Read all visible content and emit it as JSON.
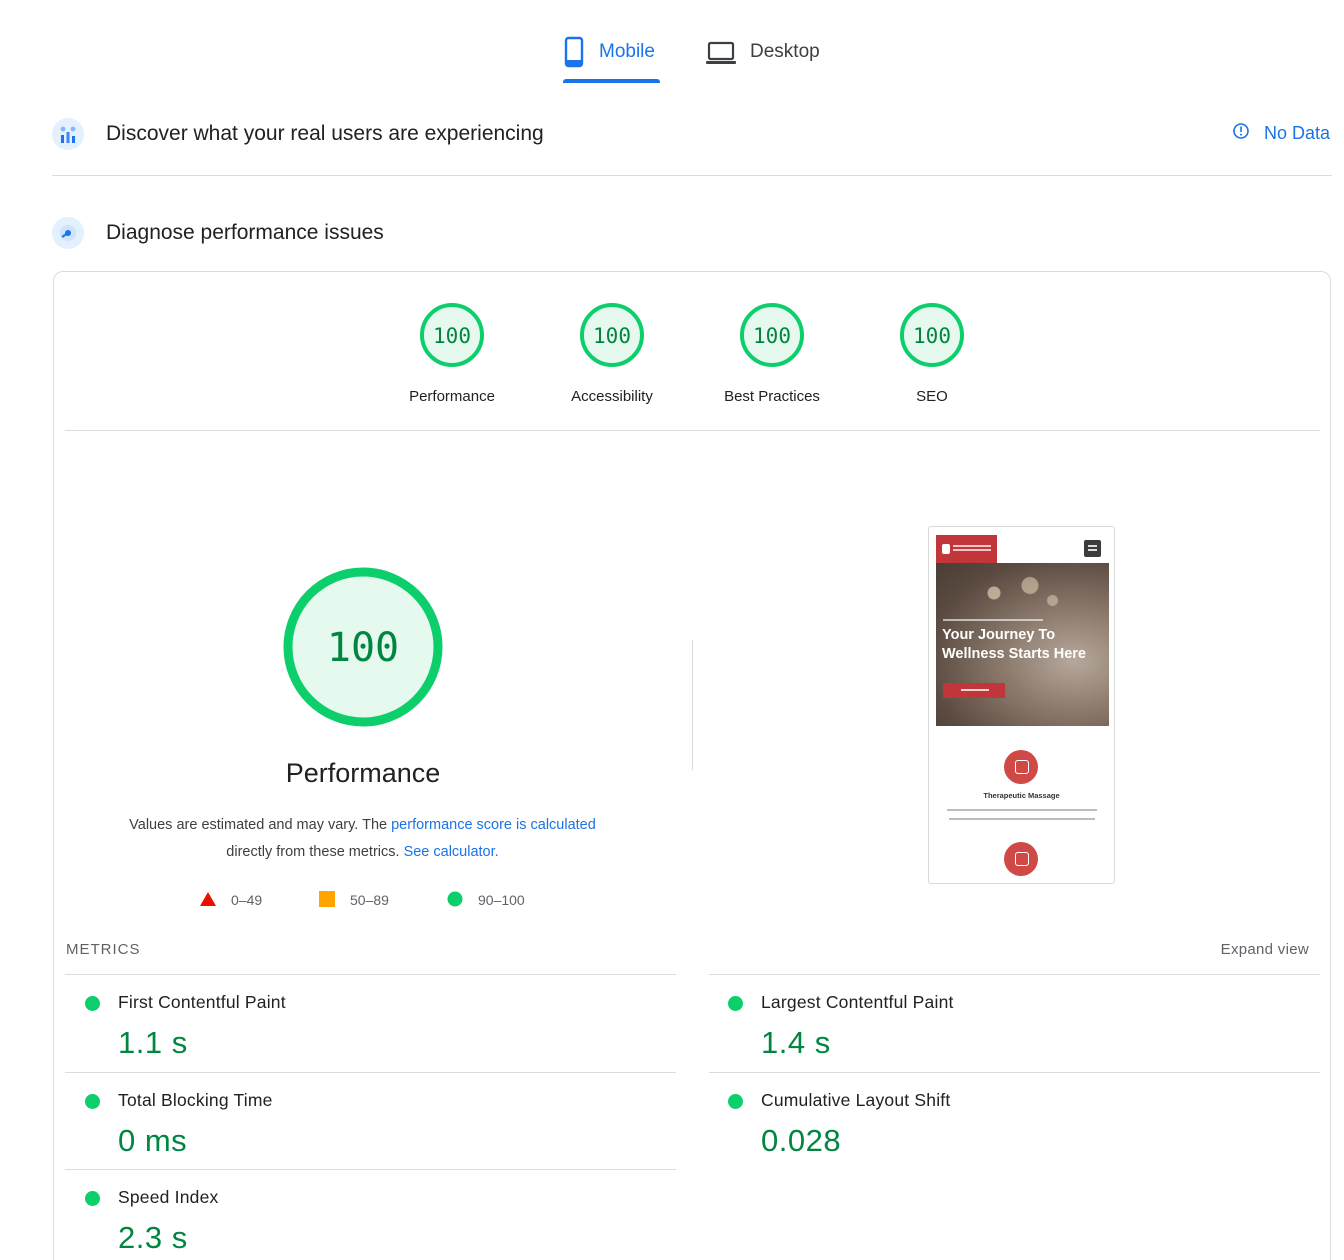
{
  "tabs": [
    {
      "label": "Mobile",
      "active": true,
      "icon": "phone-icon"
    },
    {
      "label": "Desktop",
      "active": false,
      "icon": "laptop-icon"
    }
  ],
  "crux": {
    "title": "Discover what your real users are experiencing",
    "status": "No Data",
    "icon": "users-chart-icon"
  },
  "diagnose": {
    "title": "Diagnose performance issues",
    "icon": "speedometer-icon"
  },
  "categories": [
    {
      "score": "100",
      "label": "Performance"
    },
    {
      "score": "100",
      "label": "Accessibility"
    },
    {
      "score": "100",
      "label": "Best Practices"
    },
    {
      "score": "100",
      "label": "SEO"
    }
  ],
  "performance": {
    "score": "100",
    "title": "Performance",
    "desc_prefix": "Values are estimated and may vary. The ",
    "desc_link1": "performance score is calculated",
    "desc_middle": " directly from these metrics. ",
    "desc_link2": "See calculator."
  },
  "legend": [
    {
      "range": "0–49",
      "shape": "triangle",
      "color": "#eb0f00"
    },
    {
      "range": "50–89",
      "shape": "square",
      "color": "#ffa400"
    },
    {
      "range": "90–100",
      "shape": "circle",
      "color": "#0cce6b"
    }
  ],
  "screenshot": {
    "headline": "Your Journey To Wellness Starts Here",
    "service_title": "Therapeutic Massage"
  },
  "metrics_section": {
    "label": "METRICS",
    "expand": "Expand view"
  },
  "metrics": [
    {
      "name": "First Contentful Paint",
      "value": "1.1 s"
    },
    {
      "name": "Largest Contentful Paint",
      "value": "1.4 s"
    },
    {
      "name": "Total Blocking Time",
      "value": "0 ms"
    },
    {
      "name": "Cumulative Layout Shift",
      "value": "0.028"
    },
    {
      "name": "Speed Index",
      "value": "2.3 s"
    }
  ],
  "colors": {
    "pass": "#0cce6b",
    "pass_text": "#018642",
    "gauge_fill": "#e6f9ee",
    "link": "#1a73e8"
  }
}
